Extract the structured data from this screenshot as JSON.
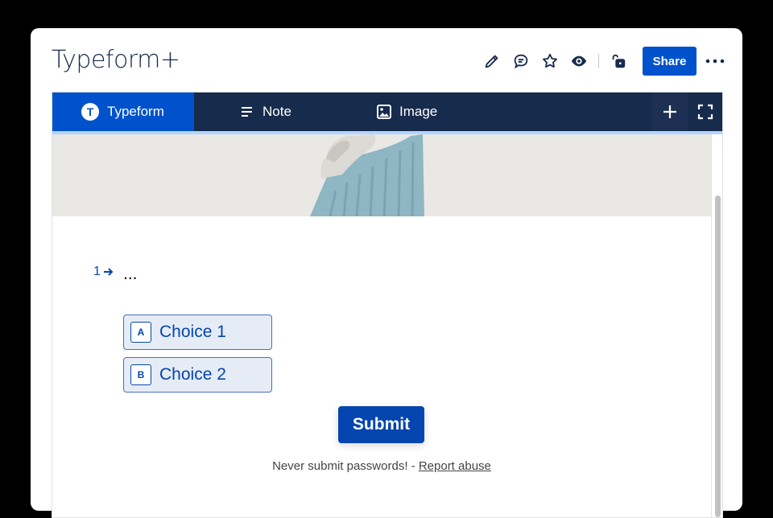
{
  "page": {
    "title": "Typeform+"
  },
  "toolbar": {
    "icons": [
      "pencil-icon",
      "comment-icon",
      "star-icon",
      "eye-icon",
      "unlock-icon",
      "more-icon"
    ],
    "share_label": "Share"
  },
  "embed": {
    "tabs": [
      {
        "label": "Typeform",
        "icon": "typeform-icon",
        "active": true
      },
      {
        "label": "Note",
        "icon": "note-icon",
        "active": false
      },
      {
        "label": "Image",
        "icon": "image-icon",
        "active": false
      }
    ],
    "actions": [
      "plus-icon",
      "fullscreen-icon"
    ]
  },
  "form": {
    "question_number": "1",
    "question_text": "...",
    "choices": [
      {
        "key": "A",
        "label": "Choice 1"
      },
      {
        "key": "B",
        "label": "Choice 2"
      }
    ],
    "submit_label": "Submit",
    "footer_text": "Never submit passwords! - ",
    "footer_link": "Report abuse"
  },
  "colors": {
    "brand_blue": "#0052cc",
    "tab_bar": "#172b4d",
    "form_accent": "#0445af"
  }
}
